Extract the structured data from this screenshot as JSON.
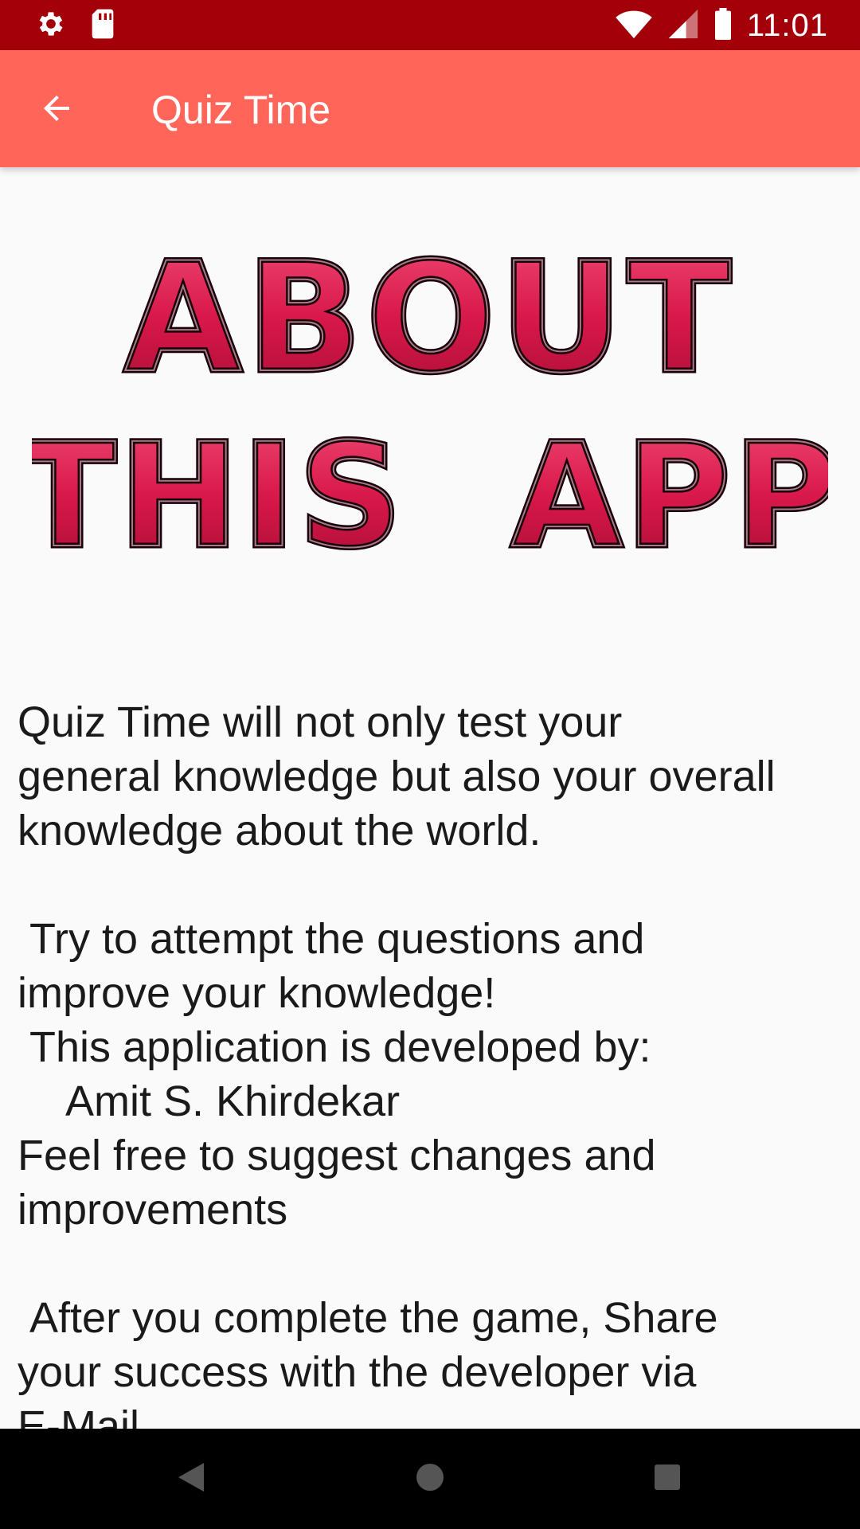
{
  "status_bar": {
    "time": "11:01",
    "icons_left": [
      "gear-icon",
      "sd-card-icon"
    ],
    "icons_right": [
      "wifi-icon",
      "cell-signal-icon",
      "battery-icon"
    ]
  },
  "app_bar": {
    "title": "Quiz Time",
    "back_icon": "arrow-back-icon"
  },
  "banner": {
    "line1": "ABOUT",
    "line2": "THIS  APP"
  },
  "about": {
    "paragraph1": "Quiz Time will not only test your\ngeneral knowledge but also your overall\nknowledge about the world.",
    "paragraph2": " Try to attempt the questions and\nimprove your knowledge!\n This application is developed by:\n    Amit S. Khirdekar\nFeel free to suggest changes and\nimprovements",
    "paragraph3": " After you complete the game, Share\nyour success with the developer via\nE-Mail."
  },
  "nav_bar": {
    "buttons": [
      "back-triangle-icon",
      "home-circle-icon",
      "recents-square-icon"
    ]
  },
  "colors": {
    "status_bar": "#a30009",
    "app_bar": "#ff6659",
    "background": "#fafafa",
    "banner_fill": "#d8184a",
    "banner_outline": "#1a0008"
  }
}
